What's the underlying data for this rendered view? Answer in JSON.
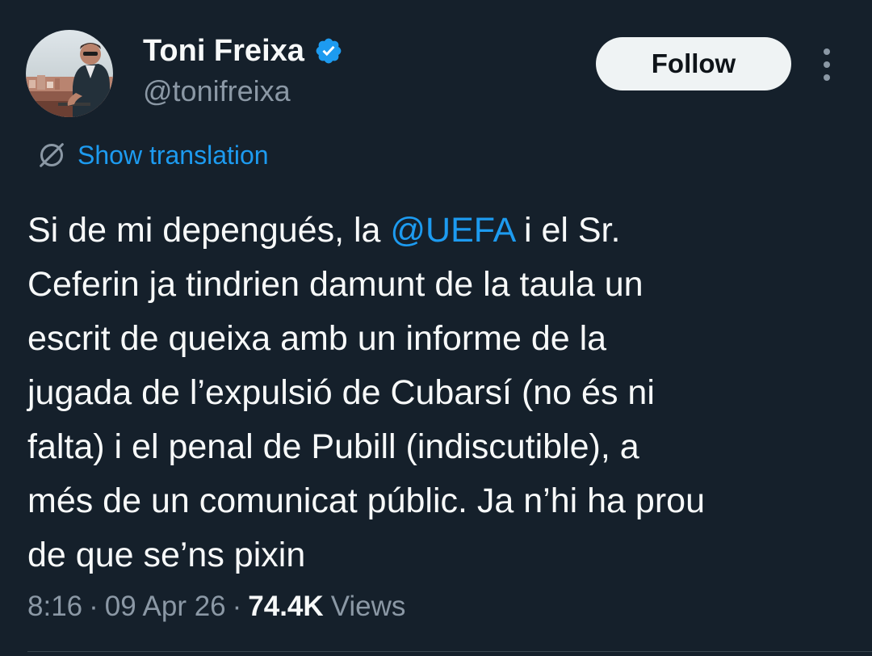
{
  "author": {
    "display_name": "Toni Freixa",
    "handle": "@tonifreixa",
    "verified": true,
    "avatar_icon": "profile-photo"
  },
  "actions": {
    "follow_label": "Follow",
    "more_icon": "more-vertical-icon"
  },
  "translation": {
    "icon": "globe-icon",
    "label": "Show translation"
  },
  "tweet": {
    "text_before_mention": "Si de mi depengués, la ",
    "mention": "@UEFA",
    "text_after_mention": " i el Sr.\nCeferin ja tindrien damunt de la taula un\nescrit de queixa amb un informe de la\njugada de l’expulsió de Cubarsí (no és ni\nfalta) i el penal de Pubill (indiscutible), a\nmés de un comunicat públic. Ja n’hi ha prou\nde que se’ns pixin"
  },
  "meta": {
    "time": "8:16",
    "date": "09 Apr 26",
    "separator": "·",
    "views_count": "74.4K",
    "views_label": "Views"
  },
  "colors": {
    "background": "#15202b",
    "accent": "#1d9bf0",
    "secondary_text": "#8b98a5",
    "button_bg": "#eff3f4"
  }
}
